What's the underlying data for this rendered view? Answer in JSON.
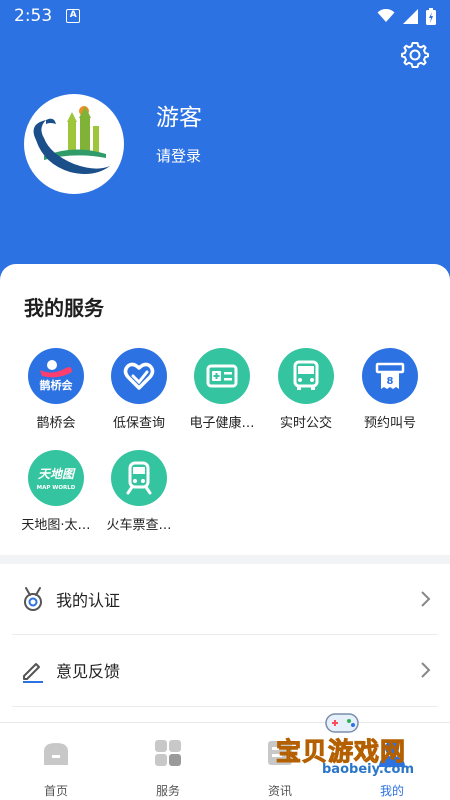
{
  "status_bar": {
    "time": "2:53",
    "notif_letter": "A"
  },
  "profile": {
    "name": "游客",
    "login_prompt": "请登录"
  },
  "services": {
    "title": "我的服务",
    "items": [
      {
        "label": "鹊桥会",
        "icon": "queqiao-logo",
        "color": "#2d72e2",
        "badge_text": "鹊桥会"
      },
      {
        "label": "低保查询",
        "icon": "heart-icon",
        "color": "#2d72e2"
      },
      {
        "label": "电子健康…",
        "icon": "health-card-icon",
        "color": "#35c4a0"
      },
      {
        "label": "实时公交",
        "icon": "bus-icon",
        "color": "#35c4a0"
      },
      {
        "label": "预约叫号",
        "icon": "ticket-icon",
        "color": "#2d72e2",
        "badge_text": "8"
      },
      {
        "label": "天地图·太…",
        "icon": "mapworld-logo",
        "color": "#35c4a0",
        "badge_text": "天地图",
        "badge_sub": "MAP WORLD"
      },
      {
        "label": "火车票查…",
        "icon": "train-icon",
        "color": "#35c4a0"
      }
    ]
  },
  "menu": [
    {
      "label": "我的认证",
      "icon": "medal-icon"
    },
    {
      "label": "意见反馈",
      "icon": "edit-icon"
    }
  ],
  "tabs": [
    {
      "label": "首页",
      "icon": "home-icon",
      "active": false
    },
    {
      "label": "服务",
      "icon": "grid-icon",
      "active": false
    },
    {
      "label": "资讯",
      "icon": "news-icon",
      "active": false
    },
    {
      "label": "我的",
      "icon": "user-icon",
      "active": true
    }
  ],
  "watermark": {
    "title": "宝贝游戏网",
    "url": "baobeiy.com"
  },
  "colors": {
    "primary": "#2d72e2",
    "teal": "#35c4a0",
    "divider": "#f2f3f5"
  }
}
